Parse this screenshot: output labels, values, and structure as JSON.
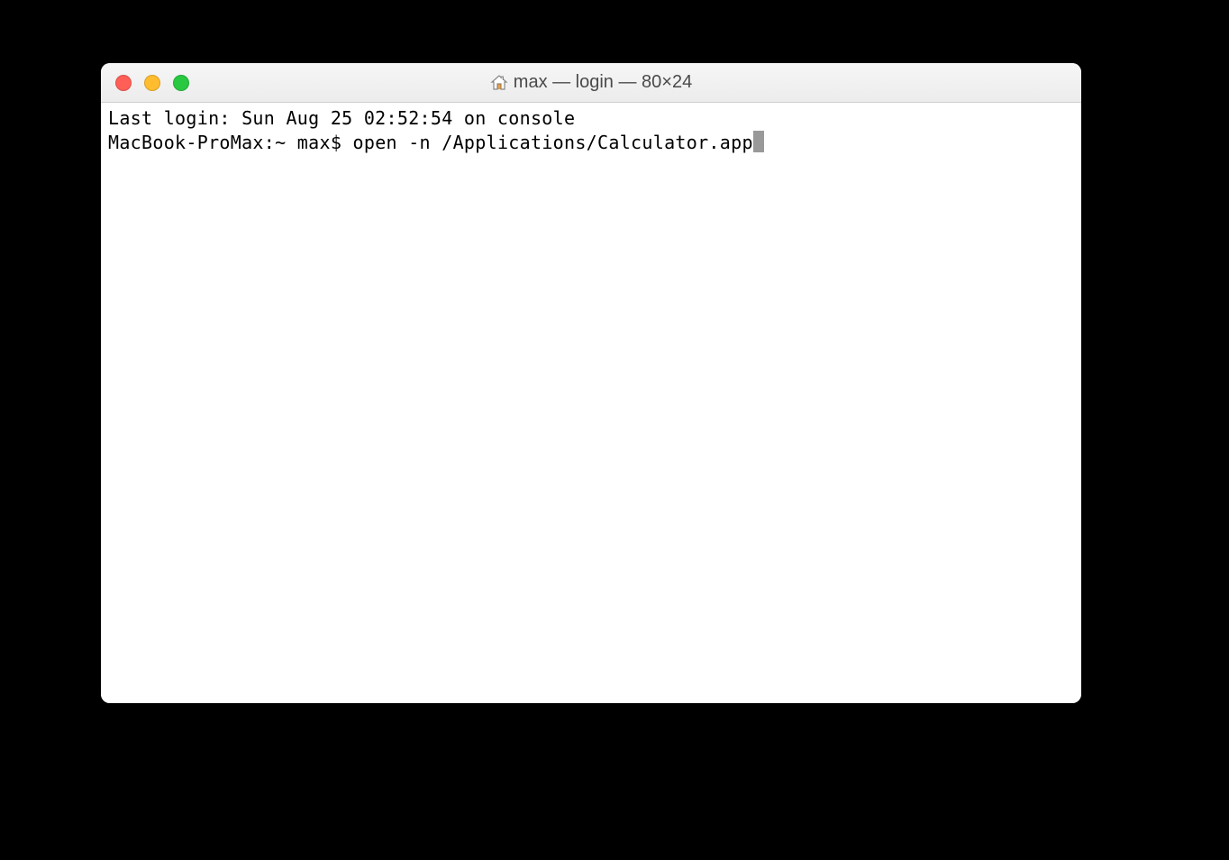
{
  "window": {
    "title": "max — login — 80×24"
  },
  "terminal": {
    "lines": [
      "Last login: Sun Aug 25 02:52:54 on console"
    ],
    "prompt": "MacBook-ProMax:~ max$ ",
    "command": "open -n /Applications/Calculator.app"
  }
}
